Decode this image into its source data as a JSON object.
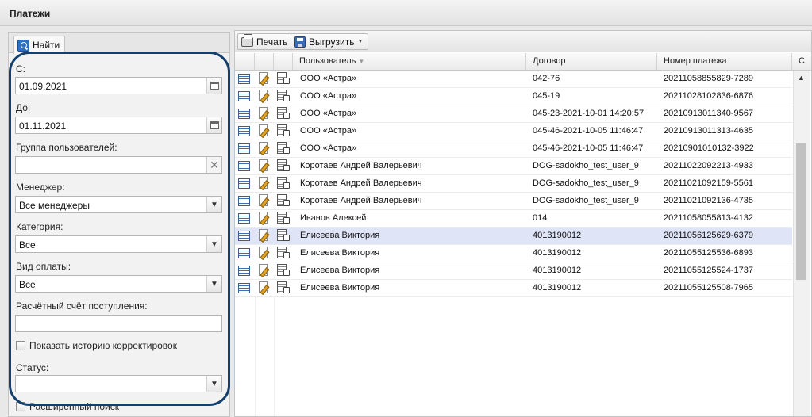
{
  "panel": {
    "title": "Платежи"
  },
  "filter": {
    "tab_label": "Найти",
    "from_label": "С:",
    "from_value": "01.09.2021",
    "to_label": "До:",
    "to_value": "01.11.2021",
    "user_group_label": "Группа пользователей:",
    "user_group_value": "",
    "manager_label": "Менеджер:",
    "manager_value": "Все менеджеры",
    "category_label": "Категория:",
    "category_value": "Все",
    "payment_type_label": "Вид оплаты:",
    "payment_type_value": "Все",
    "account_label": "Расчётный счёт поступления:",
    "account_value": "",
    "show_history_label": "Показать историю корректировок",
    "status_label": "Статус:",
    "status_value": "",
    "advanced_label": "Расширенный поиск"
  },
  "toolbar": {
    "print_label": "Печать",
    "export_label": "Выгрузить"
  },
  "columns": {
    "user": "Пользователь",
    "contract": "Договор",
    "payment_no": "Номер платежа",
    "extra": "С"
  },
  "rows": [
    {
      "user": "ООО «Астра»",
      "contract": "042-76",
      "payment_no": "20211058855829-7289"
    },
    {
      "user": "ООО «Астра»",
      "contract": "045-19",
      "payment_no": "20211028102836-6876"
    },
    {
      "user": "ООО «Астра»",
      "contract": "045-23-2021-10-01 14:20:57",
      "payment_no": "20210913011340-9567"
    },
    {
      "user": "ООО «Астра»",
      "contract": "045-46-2021-10-05 11:46:47",
      "payment_no": "20210913011313-4635"
    },
    {
      "user": "ООО «Астра»",
      "contract": "045-46-2021-10-05 11:46:47",
      "payment_no": "20210901010132-3922"
    },
    {
      "user": "Коротаев Андрей Валерьевич",
      "contract": "DOG-sadokho_test_user_9",
      "payment_no": "20211022092213-4933"
    },
    {
      "user": "Коротаев Андрей Валерьевич",
      "contract": "DOG-sadokho_test_user_9",
      "payment_no": "20211021092159-5561"
    },
    {
      "user": "Коротаев Андрей Валерьевич",
      "contract": "DOG-sadokho_test_user_9",
      "payment_no": "20211021092136-4735"
    },
    {
      "user": "Иванов Алексей",
      "contract": "014",
      "payment_no": "20211058055813-4132"
    },
    {
      "user": "Елисеева Виктория",
      "contract": "4013190012",
      "payment_no": "20211056125629-6379"
    },
    {
      "user": "Елисеева Виктория",
      "contract": "4013190012",
      "payment_no": "20211055125536-6893"
    },
    {
      "user": "Елисеева Виктория",
      "contract": "4013190012",
      "payment_no": "20211055125524-1737"
    },
    {
      "user": "Елисеева Виктория",
      "contract": "4013190012",
      "payment_no": "20211055125508-7965"
    }
  ],
  "selected_row_index": 9,
  "icons": [
    "search-icon",
    "calendar-icon",
    "clear-icon",
    "chevron-down-icon",
    "print-icon",
    "save-icon",
    "details-icon",
    "edit-icon",
    "document-icon"
  ],
  "colors": {
    "highlight_ring": "#123f6d",
    "selected_row": "#dfe4f7"
  }
}
